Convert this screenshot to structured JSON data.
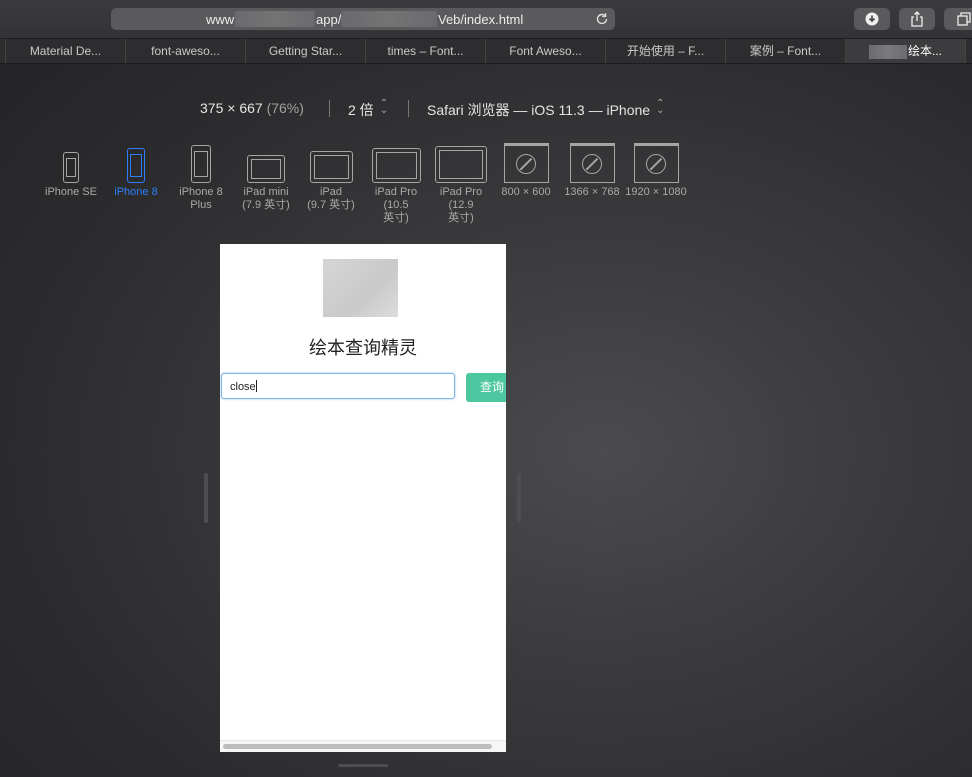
{
  "toolbar": {
    "url_parts": [
      "www",
      "app/",
      "Veb/index.html"
    ],
    "reload_icon": "reload-icon",
    "buttons": [
      {
        "name": "download-icon"
      },
      {
        "name": "share-icon"
      },
      {
        "name": "tabs-overview-icon"
      }
    ]
  },
  "tabs": [
    {
      "label": "Material De..."
    },
    {
      "label": "font-aweso..."
    },
    {
      "label": "Getting Star..."
    },
    {
      "label": "times – Font..."
    },
    {
      "label": "Font Aweso..."
    },
    {
      "label": "开始使用 – F..."
    },
    {
      "label": "案例 – Font..."
    },
    {
      "label": "绘本..."
    }
  ],
  "responsive": {
    "dimensions": "375 × 667",
    "zoom": "(76%)",
    "scale": "2 倍",
    "user_agent": "Safari 浏览器 — iOS 11.3 — iPhone"
  },
  "devices": [
    {
      "label1": "iPhone SE",
      "label2": ""
    },
    {
      "label1": "iPhone 8",
      "label2": ""
    },
    {
      "label1": "iPhone 8",
      "label2": "Plus"
    },
    {
      "label1": "iPad mini",
      "label2": "(7.9 英寸)"
    },
    {
      "label1": "iPad",
      "label2": "(9.7 英寸)"
    },
    {
      "label1": "iPad Pro",
      "label2": "(10.5",
      "label3": "英寸)"
    },
    {
      "label1": "iPad Pro",
      "label2": "(12.9",
      "label3": "英寸)"
    },
    {
      "label1": "800 × 600",
      "label2": ""
    },
    {
      "label1": "1366 × 768",
      "label2": ""
    },
    {
      "label1": "1920 × 1080",
      "label2": ""
    }
  ],
  "selected_device": "iPhone 8",
  "app": {
    "title": "绘本查询精灵",
    "search_value": "close",
    "search_button": "查询"
  },
  "colors": {
    "accent_selected": "#2d7ff9",
    "search_button": "#4cc79f",
    "input_focus": "#7fb6e6"
  }
}
